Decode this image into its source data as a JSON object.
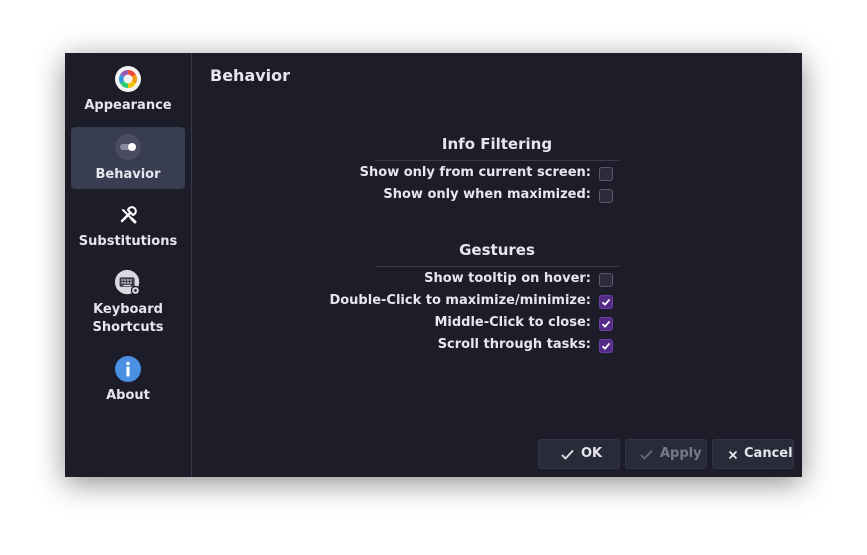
{
  "sidebar": {
    "items": [
      {
        "label": "Appearance",
        "icon": "color-wheel-icon",
        "active": false
      },
      {
        "label": "Behavior",
        "icon": "toggle-icon",
        "active": true
      },
      {
        "label": "Substitutions",
        "icon": "substitution-tools-icon",
        "active": false
      },
      {
        "label": "Keyboard",
        "label2": "Shortcuts",
        "icon": "keyboard-icon",
        "active": false
      },
      {
        "label": "About",
        "icon": "info-icon",
        "active": false
      }
    ]
  },
  "page": {
    "title": "Behavior"
  },
  "info_filtering": {
    "title": "Info Filtering",
    "options": [
      {
        "label": "Show only from current screen:",
        "checked": false
      },
      {
        "label": "Show only when maximized:",
        "checked": false
      }
    ]
  },
  "gestures": {
    "title": "Gestures",
    "options": [
      {
        "label": "Show tooltip on hover:",
        "checked": false
      },
      {
        "label": "Double-Click to maximize/minimize:",
        "checked": true
      },
      {
        "label": "Middle-Click to close:",
        "checked": true
      },
      {
        "label": "Scroll through tasks:",
        "checked": true
      }
    ]
  },
  "buttons": {
    "ok": "OK",
    "apply": "Apply",
    "cancel": "Cancel"
  },
  "colors": {
    "window_bg": "#1d1d29",
    "active_item": "#393d52",
    "check_on": "#542a86",
    "info_blue": "#4a90e2"
  }
}
